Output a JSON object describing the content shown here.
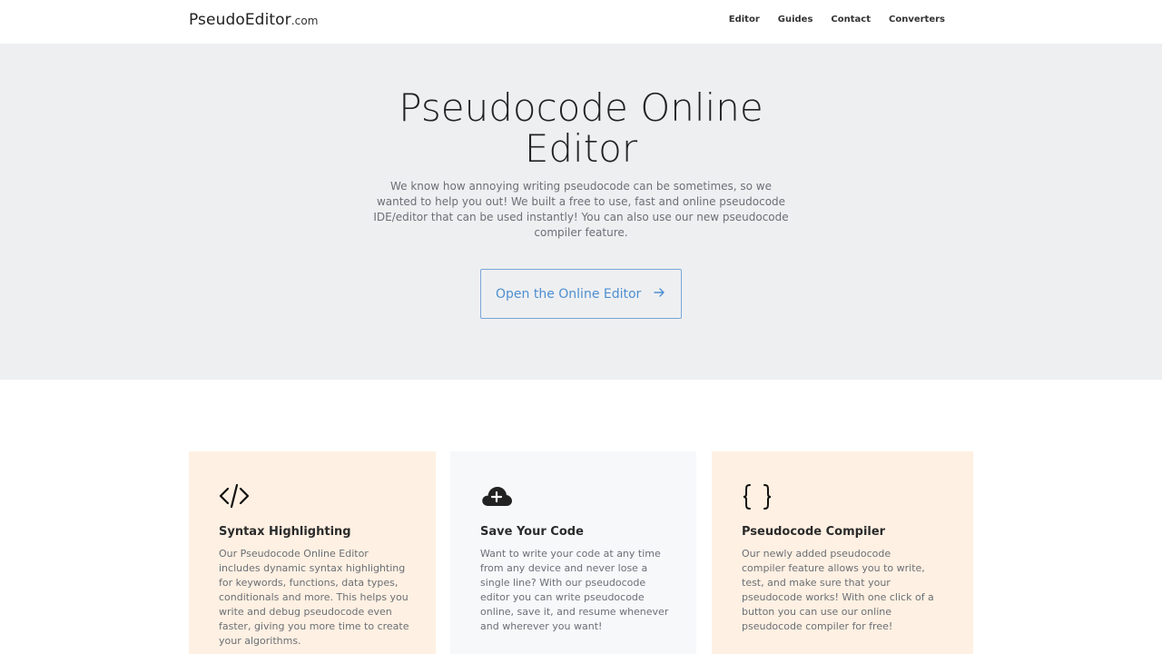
{
  "nav": {
    "brand_main": "PseudoEditor",
    "brand_suffix": ".com",
    "links": [
      "Editor",
      "Guides",
      "Contact",
      "Converters"
    ]
  },
  "hero": {
    "title": "Pseudocode Online Editor",
    "description": "We know how annoying writing pseudocode can be sometimes, so we wanted to help you out! We built a free to use, fast and online pseudocode IDE/editor that can be used instantly! You can also use our new pseudocode compiler feature.",
    "cta_label": "Open the Online Editor",
    "cta_icon": "arrow-right-icon"
  },
  "features": [
    {
      "icon": "code-icon",
      "title": "Syntax Highlighting",
      "text": "Our Pseudocode Online Editor includes dynamic syntax highlighting for keywords, functions, data types, conditionals and more. This helps you write and debug pseudocode even faster, giving you more time to create your algorithms."
    },
    {
      "icon": "cloud-upload-icon",
      "title": "Save Your Code",
      "text": "Want to write your code at any time from any device and never lose a single line? With our pseudocode editor you can write pseudocode online, save it, and resume whenever and wherever you want!"
    },
    {
      "icon": "braces-icon",
      "title": "Pseudocode Compiler",
      "text": "Our newly added pseudocode compiler feature allows you to write, test, and make sure that your pseudocode works! With one click of a button you can use our online pseudocode compiler for free!"
    }
  ],
  "colors": {
    "hero_bg": "#eeeff1",
    "accent": "#4d8fd1",
    "card_warm": "#fef0e2",
    "card_cool": "#f6f8fa"
  }
}
